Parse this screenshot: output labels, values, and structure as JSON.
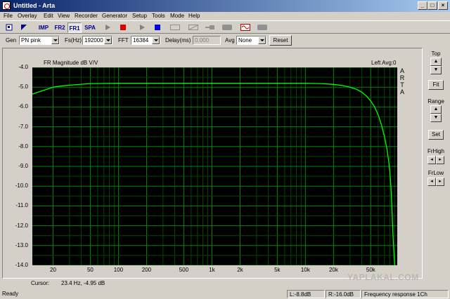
{
  "window": {
    "title": "Untitled - Arta"
  },
  "menu": [
    "File",
    "Overlay",
    "Edit",
    "View",
    "Recorder",
    "Generator",
    "Setup",
    "Tools",
    "Mode",
    "Help"
  ],
  "toolbar": {
    "imp": "IMP",
    "fr2": "FR2",
    "fr1": "FR1",
    "spa": "SPA"
  },
  "controls": {
    "gen_label": "Gen",
    "gen_value": "PN pink",
    "fs_label": "Fs(Hz)",
    "fs_value": "192000",
    "fft_label": "FFT",
    "fft_value": "16384",
    "delay_label": "Delay(ms)",
    "delay_value": "0.000",
    "avg_label": "Avg",
    "avg_value": "None",
    "reset_label": "Reset"
  },
  "plot": {
    "title": "FR Magnitude dB V/V",
    "avg_text": "Left  Avg:0",
    "side_letters": [
      "A",
      "R",
      "T",
      "A"
    ],
    "x_axis_unit": "Hz",
    "cursor_label": "Cursor:",
    "cursor_value": "23.4 Hz, -4.95 dB"
  },
  "chart_data": {
    "type": "line",
    "title": "FR Magnitude dB V/V",
    "xlabel": "Hz",
    "ylabel": "",
    "x_scale": "log",
    "xlim": [
      12,
      96000
    ],
    "ylim": [
      -14.0,
      -4.0
    ],
    "grid": true,
    "y_ticks": [
      "-4.0",
      "-5.0",
      "-6.0",
      "-7.0",
      "-8.0",
      "-9.0",
      "-10.0",
      "-11.0",
      "-12.0",
      "-13.0",
      "-14.0"
    ],
    "x_ticks": [
      {
        "value": 20,
        "label": "20"
      },
      {
        "value": 50,
        "label": "50"
      },
      {
        "value": 100,
        "label": "100"
      },
      {
        "value": 200,
        "label": "200"
      },
      {
        "value": 500,
        "label": "500"
      },
      {
        "value": 1000,
        "label": "1k"
      },
      {
        "value": 2000,
        "label": "2k"
      },
      {
        "value": 5000,
        "label": "5k"
      },
      {
        "value": 10000,
        "label": "10k"
      },
      {
        "value": 20000,
        "label": "20k"
      },
      {
        "value": 50000,
        "label": "50k"
      }
    ],
    "series": [
      {
        "color": "#00ff00",
        "x": [
          12,
          15,
          20,
          23.4,
          30,
          50,
          100,
          200,
          500,
          1000,
          2000,
          5000,
          10000,
          15000,
          20000,
          25000,
          30000,
          35000,
          40000,
          45000,
          50000,
          55000,
          60000,
          65000,
          70000,
          75000,
          78000,
          80000,
          82000,
          84000,
          86000,
          88000,
          90000
        ],
        "y": [
          -5.35,
          -5.2,
          -5.0,
          -4.95,
          -4.9,
          -4.82,
          -4.8,
          -4.8,
          -4.8,
          -4.8,
          -4.8,
          -4.8,
          -4.8,
          -4.82,
          -4.86,
          -4.92,
          -5.0,
          -5.1,
          -5.25,
          -5.45,
          -5.7,
          -6.0,
          -6.4,
          -6.9,
          -7.5,
          -8.2,
          -8.8,
          -9.3,
          -10.0,
          -11.0,
          -12.2,
          -13.2,
          -14.0
        ]
      }
    ]
  },
  "right_panel": {
    "top": "Top",
    "fit": "Fit",
    "range": "Range",
    "set": "Set",
    "frhigh": "FrHigh",
    "frlow": "FrLow"
  },
  "status": {
    "ready": "Ready",
    "l": "L:-8.8dB",
    "r": "R:-16.0dB",
    "mode": "Frequency response 1Ch"
  },
  "watermark": "YAPLAKAL.COM",
  "colors": {
    "trace": "#00ff00",
    "grid_major": "#008800",
    "grid_minor": "#004800",
    "plot_bg": "#000000"
  }
}
